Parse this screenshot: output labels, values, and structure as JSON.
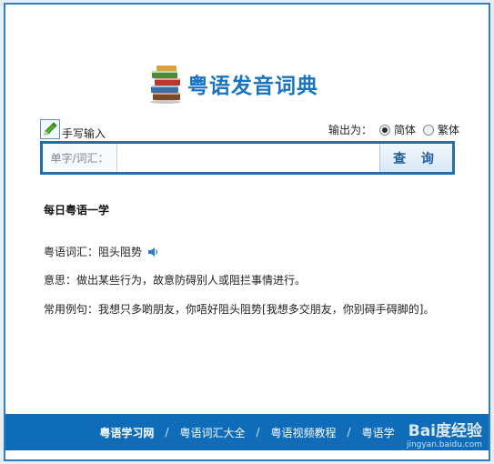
{
  "header": {
    "title": "粤语发音词典",
    "handwrite_label": "手写输入",
    "output_label": "输出为：",
    "output_options": [
      "简体",
      "繁体"
    ],
    "output_selected": "简体"
  },
  "search": {
    "prefix": "单字/词汇：",
    "value": "",
    "button_label": "查 询"
  },
  "daily": {
    "title": "每日粤语一学",
    "word_label": "粤语词汇：",
    "word": "阻头阻势",
    "meaning_label": "意思：",
    "meaning": "做出某些行为，故意防碍别人或阻拦事情进行。",
    "example_label": "常用例句：",
    "example": "我想只多啲朋友，你唔好阻头阻势[我想多交朋友，你别碍手碍脚的]。"
  },
  "footer": {
    "links": [
      "粤语学习网",
      "粤语词汇大全",
      "粤语视频教程",
      "粤语学"
    ],
    "separator": "/"
  },
  "watermark": {
    "main": "Bai度经验",
    "sub": "jingyan.baidu.com"
  },
  "colors": {
    "brand_blue": "#1a74c0",
    "footer_blue": "#0e6cb8",
    "border_blue": "#1f6fb2"
  }
}
